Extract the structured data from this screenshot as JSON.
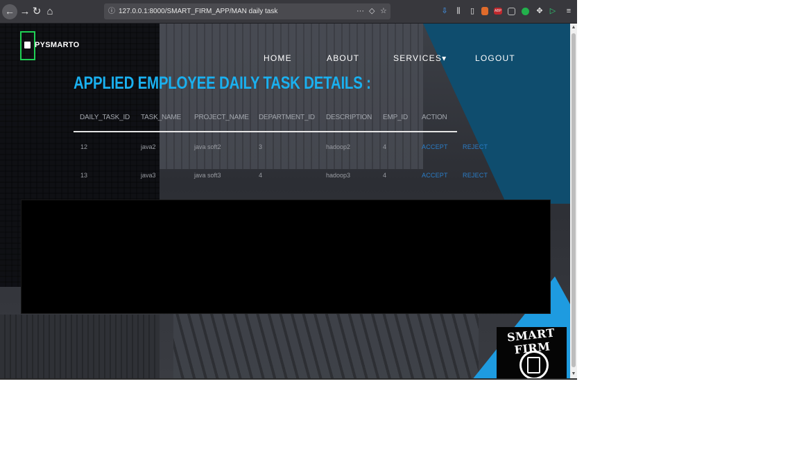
{
  "browser": {
    "url": "127.0.0.1:8000/SMART_FIRM_APP/MAN daily task",
    "icons": [
      "back-arrow-icon",
      "forward-arrow-icon",
      "reload-icon",
      "home-icon",
      "info-icon",
      "more-icon",
      "pocket-icon",
      "bookmark-star-icon",
      "download-icon",
      "library-icon",
      "sidebar-icon",
      "extension-icon",
      "adblock-icon",
      "extension-icon",
      "extension-icon",
      "extension-icon",
      "play-icon",
      "menu-icon"
    ]
  },
  "brand": {
    "name": "PYSMARTO"
  },
  "nav": {
    "home": "HOME",
    "about": "ABOUT",
    "services": "SERVICES▾",
    "logout": "LOGOUT"
  },
  "heading": "APPLIED EMPLOYEE DAILY TASK DETAILS :",
  "table": {
    "headers": [
      "DAILY_TASK_ID",
      "TASK_NAME",
      "PROJECT_NAME",
      "DEPARTMENT_ID",
      "DESCRIPTION",
      "EMP_ID",
      "ACTION"
    ],
    "rows": [
      {
        "daily_task_id": "12",
        "task_name": "java2",
        "project_name": "java soft2",
        "department_id": "3",
        "description": "hadoop2",
        "emp_id": "4",
        "accept": "ACCEPT",
        "reject": "REJECT"
      },
      {
        "daily_task_id": "13",
        "task_name": "java3",
        "project_name": "java soft3",
        "department_id": "4",
        "description": "hadoop3",
        "emp_id": "4",
        "accept": "ACCEPT",
        "reject": "REJECT"
      }
    ]
  },
  "logo": {
    "text": "SMART FIRM"
  },
  "colors": {
    "heading": "#1ab0ef",
    "teal": "#0f4d6e",
    "blue": "#1e9be0",
    "action": "#2a7ec9",
    "brand_border": "#1fd155"
  }
}
